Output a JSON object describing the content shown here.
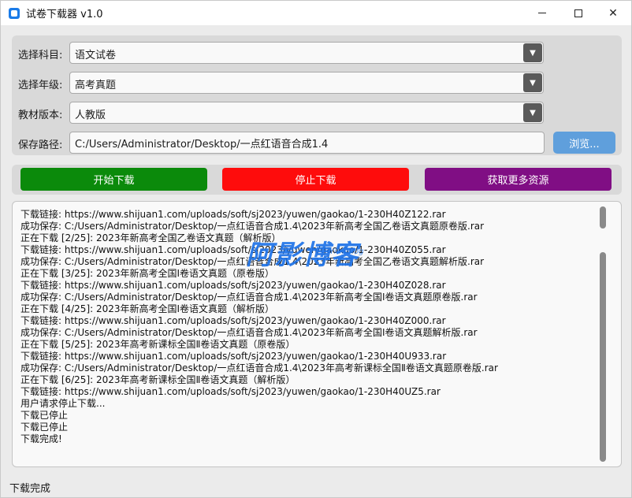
{
  "window": {
    "title": "试卷下载器 v1.0",
    "minimize": "—",
    "maximize": "□",
    "close": "✕"
  },
  "form": {
    "subject": {
      "label": "选择科目:",
      "value": "语文试卷"
    },
    "grade": {
      "label": "选择年级:",
      "value": "高考真题"
    },
    "edition": {
      "label": "教材版本:",
      "value": "人教版"
    },
    "save_path": {
      "label": "保存路径:",
      "value": "C:/Users/Administrator/Desktop/一点红语音合成1.4"
    },
    "browse_label": "浏览...",
    "dropdown_icon": "chevron-down-icon"
  },
  "actions": {
    "start": "开始下载",
    "stop": "停止下载",
    "more": "获取更多资源"
  },
  "log": {
    "lines": [
      "下载链接: https://www.shijuan1.com/uploads/soft/sj2023/yuwen/gaokao/1-230H40Z122.rar",
      "成功保存: C:/Users/Administrator/Desktop/一点红语音合成1.4\\2023年新高考全国乙卷语文真题原卷版.rar",
      "正在下载 [2/25]: 2023年新高考全国乙卷语文真题（解析版）",
      "下载链接: https://www.shijuan1.com/uploads/soft/sj2023/yuwen/gaokao/1-230H40Z055.rar",
      "成功保存: C:/Users/Administrator/Desktop/一点红语音合成1.4\\2023年新高考全国乙卷语文真题解析版.rar",
      "正在下载 [3/25]: 2023年新高考全国Ⅰ卷语文真题（原卷版）",
      "下载链接: https://www.shijuan1.com/uploads/soft/sj2023/yuwen/gaokao/1-230H40Z028.rar",
      "成功保存: C:/Users/Administrator/Desktop/一点红语音合成1.4\\2023年新高考全国Ⅰ卷语文真题原卷版.rar",
      "正在下载 [4/25]: 2023年新高考全国Ⅰ卷语文真题（解析版）",
      "下载链接: https://www.shijuan1.com/uploads/soft/sj2023/yuwen/gaokao/1-230H40Z000.rar",
      "成功保存: C:/Users/Administrator/Desktop/一点红语音合成1.4\\2023年新高考全国Ⅰ卷语文真题解析版.rar",
      "正在下载 [5/25]: 2023年高考新课标全国Ⅱ卷语文真题（原卷版）",
      "下载链接: https://www.shijuan1.com/uploads/soft/sj2023/yuwen/gaokao/1-230H40U933.rar",
      "成功保存: C:/Users/Administrator/Desktop/一点红语音合成1.4\\2023年高考新课标全国Ⅱ卷语文真题原卷版.rar",
      "正在下载 [6/25]: 2023年高考新课标全国Ⅱ卷语文真题（解析版）",
      "下载链接: https://www.shijuan1.com/uploads/soft/sj2023/yuwen/gaokao/1-230H40UZ5.rar",
      "用户请求停止下载...",
      "下载已停止",
      "下载已停止",
      "下载完成!"
    ],
    "watermark": "阿影博客",
    "watermark_sub": "YingBlog"
  },
  "status": "下载完成",
  "colors": {
    "start": "#0b8a0b",
    "stop": "#fe0c0c",
    "more": "#800e84",
    "browse": "#5f9fdc",
    "watermark": "#1e73e8"
  }
}
